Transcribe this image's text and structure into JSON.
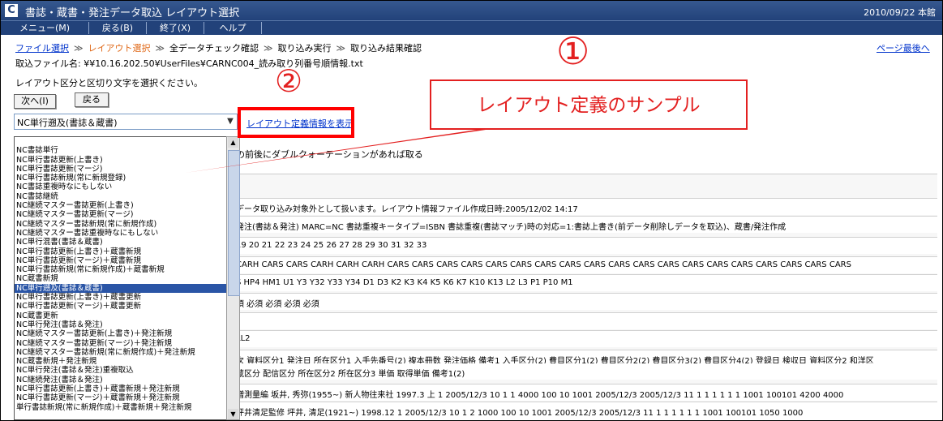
{
  "window": {
    "icon_glyph": "C",
    "title": "書誌・蔵書・発注データ取込 レイアウト選択",
    "date_location": "2010/09/22 本館"
  },
  "menu": [
    {
      "label": "メニュー(M)"
    },
    {
      "label": "戻る(B)"
    },
    {
      "label": "終了(X)"
    },
    {
      "label": "ヘルプ"
    }
  ],
  "breadcrumb": {
    "sep": "≫",
    "file_select": "ファイル選択",
    "layout_select": "レイアウト選択",
    "check": "全データチェック確認",
    "import": "取り込み実行",
    "result": "取り込み結果確認"
  },
  "page_last": "ページ最後へ",
  "file_line": "取込ファイル名: ¥¥10.16.202.50¥UserFiles¥CARNC004_読み取り列番号順情報.txt",
  "instruction": "レイアウト区分と区切り文字を選択ください。",
  "buttons": {
    "next": "次へ(I)",
    "back": "戻る"
  },
  "layout_select": {
    "value": "NC単行遡及(書誌＆蔵書)",
    "options": [
      "",
      "NC書誌単行",
      "NC単行書誌更新(上書き)",
      "NC単行書誌更新(マージ)",
      "NC単行書誌新規(常に新規登録)",
      "NC書誌重複時なにもしない",
      "NC書誌継続",
      "NC継続マスター書誌更新(上書き)",
      "NC継続マスター書誌更新(マージ)",
      "NC継続マスター書誌新規(常に新規作成)",
      "NC継続マスター書誌重複時なにもしない",
      "NC単行混書(書誌＆蔵書)",
      "NC単行書誌更新(上書き)＋蔵書新規",
      "NC単行書誌更新(マージ)＋蔵書新規",
      "NC単行書誌新規(常に新規作成)＋蔵書新規",
      "NC蔵書新規",
      "NC単行遡及(書誌＆蔵書)",
      "NC単行書誌更新(上書き)＋蔵書更新",
      "NC単行書誌更新(マージ)＋蔵書更新",
      "NC蔵書更新",
      "NC単行発注(書誌＆発注)",
      "NC継続マスター書誌更新(上書き)＋発注新規",
      "NC継続マスター書誌更新(マージ)＋発注新規",
      "NC継続マスター書誌新規(常に新規作成)＋発注新規",
      "NC蔵書新規＋発注新規",
      "NC単行発注(書誌＆発注)重複取込",
      "NC継続発注(書誌＆発注)",
      "NC単行書誌更新(上書き)＋蔵書新規＋発注新規",
      "NC単行書誌更新(マージ)＋蔵書新規＋発注新規",
      "単行書誌新規(常に新規作成)＋蔵書新規＋発注新規"
    ],
    "selected_index": 16
  },
  "show_layout_link": "レイアウト定義情報を表示",
  "annotations": {
    "callout_text": "レイアウト定義のサンプル",
    "num1": "①",
    "num2": "②"
  },
  "behind": {
    "quote_note": "の前後にダブルクォーテーションがあれば取る",
    "rows": [
      "データ取り込み対象外として扱います。レイアウト情報ファイル作成日時:2005/12/02 14:17",
      "発注(書誌＆発注) MARC=NC 書誌重複キータイプ=ISBN 書誌重複(書誌マッチ)時の対応=1:書誌上書き(前データ削除しデータを取込)、蔵書/発注作成",
      "19 20 21 22 23 24 25 26 27 28 29 30 31 32 33",
      "CARH CARS CARS CARH CARH CARH CARS CARS CARS CARS CARS CARS CARS CARS CARS CARS CARS CARS CARS CARS CARS CARS CARS CARS CARS",
      "S HP4 HM1 U1 Y3 Y32 Y33 Y34 D1 D3 K2 K3 K4 K5 K6 K7 K10 K13 L2 L3 P1 P10 M1",
      "須 必須 必須 必須 必須",
      "",
      "LL2",
      "次 資料区分1 発注日 所在区分1 入手先番号(2) 複本冊数 発注価格 備考1 入手区分(2) 費目区分1(2) 費目区分2(2) 費目区分3(2) 費目区分4(2) 登録日 検収日 資料区分2 和洋区",
      "蔵区分 配信区分 所在区分2 所在区分3 単価 取得単価 備考1(2)",
      "増測量編 坂井, 秀弥(1955~) 新人物往来社 1997.3 上 1 2005/12/3 10 1 1 4000 100 10 1001 2005/12/3 2005/12/3 11 1 1 1 1 1 1 1001 100101 4200 4000",
      "坪井清足監修 坪井, 清足(1921~) 1998.12 1 2005/12/3 10 1 2 1000 100 10 1001 2005/12/3 2005/12/3 11 1 1 1 1 1 1 1001 100101 1050 1000"
    ]
  }
}
